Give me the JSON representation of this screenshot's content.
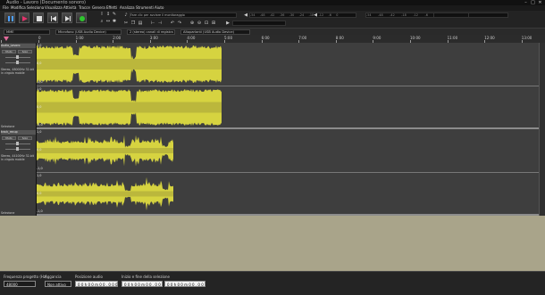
{
  "window": {
    "title": "Audio - Lavoro (Documento sonoro)"
  },
  "menu": [
    "File",
    "Modifica",
    "Seleziona",
    "Visualizza",
    "Attività",
    "Tracce",
    "Genera",
    "Effetti",
    "Analizza",
    "Strumenti",
    "Aiuto"
  ],
  "meters": {
    "record_hint": "Fare clic per avviare il monitoraggio",
    "rec_scale": [
      "-54",
      "-48",
      "-42",
      "-18",
      "-12",
      "-6",
      "0"
    ],
    "play_scale": [
      "-54",
      "-48",
      "-42",
      "-36",
      "-30",
      "-24",
      "-18",
      "-12",
      "-6",
      "0"
    ]
  },
  "devices": {
    "host": "MME",
    "mic": "Microfono (USB Audio Device)",
    "channels": "2 (stereo) canali di registra",
    "speaker": "Altoparlanti (USB Audio Device)"
  },
  "ruler": {
    "ticks": [
      "-1:00",
      "0",
      "1:00",
      "2:00",
      "3:00",
      "4:00",
      "5:00",
      "6:00",
      "7:00",
      "8:00",
      "9:00",
      "10:00",
      "11:00",
      "12:00",
      "13:00"
    ]
  },
  "tracks": [
    {
      "name": "Audio_Lavoro",
      "mute": "Muto",
      "solo": "Solo",
      "info": "Stereo, 48000Hz 32-bit in virgola mobile",
      "select": "Selezione",
      "scale_top": "1,0",
      "scale_mid": "0,0",
      "scale_bot": "-1,0",
      "end_min": 4.98
    },
    {
      "name": "track_recup",
      "mute": "Muto",
      "solo": "Solo",
      "info": "Stereo, 44100Hz 32-bit in virgola mobile",
      "select": "Selezione",
      "scale_top": "1,0",
      "scale_mid": "0,0",
      "scale_bot": "-1,0",
      "end_min": 3.67
    }
  ],
  "bottom": {
    "rate_label": "Frequenza progetto (Hz)",
    "rate_value": "48000",
    "snap_label": "Aggancia",
    "snap_value": "Non attivo",
    "pos_label": "Posizione audio",
    "pos_value": "0 0 h 0 0 m 0 0 . 0 0 0 s",
    "sel_label": "Inizio e fine della selezione",
    "sel_start": "0 0 h 0 0 m 0 0 . 0 0 0 s",
    "sel_end": "0 0 h 0 0 m 0 0 . 0 0 0 s"
  },
  "colors": {
    "wave": "#d6d340",
    "wave_dark": "#a8a53a",
    "track_bg": "#3e3e3e",
    "empty": "#a9a48a"
  }
}
